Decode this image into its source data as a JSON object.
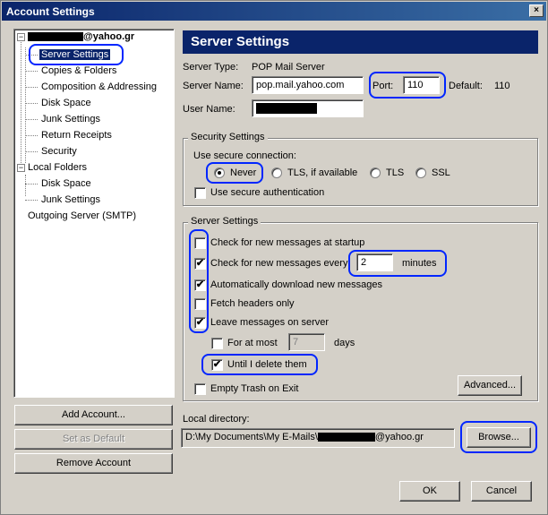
{
  "window": {
    "title": "Account Settings",
    "close_glyph": "×"
  },
  "tree": {
    "account_suffix": "@yahoo.gr",
    "account_expander": "−",
    "account_items": [
      "Server Settings",
      "Copies & Folders",
      "Composition & Addressing",
      "Disk Space",
      "Junk Settings",
      "Return Receipts",
      "Security"
    ],
    "local_folders": "Local Folders",
    "local_expander": "−",
    "local_items": [
      "Disk Space",
      "Junk Settings"
    ],
    "outgoing": "Outgoing Server (SMTP)"
  },
  "left_buttons": {
    "add": "Add Account...",
    "default": "Set as Default",
    "remove": "Remove Account"
  },
  "panel": {
    "header": "Server Settings",
    "server_type_label": "Server Type:",
    "server_type_value": "POP Mail Server",
    "server_name_label": "Server Name:",
    "server_name_value": "pop.mail.yahoo.com",
    "port_label": "Port:",
    "port_value": "110",
    "default_label": "Default:",
    "default_value": "110",
    "user_name_label": "User Name:"
  },
  "security": {
    "title": "Security Settings",
    "use_secure_label": "Use secure connection:",
    "options": [
      "Never",
      "TLS, if available",
      "TLS",
      "SSL"
    ],
    "selected": "Never",
    "secure_auth_label": "Use secure authentication"
  },
  "server_settings": {
    "title": "Server Settings",
    "check_startup": "Check for new messages at startup",
    "check_every": "Check for new messages every",
    "minutes_value": "2",
    "minutes_label": "minutes",
    "auto_download": "Automatically download new messages",
    "fetch_headers": "Fetch headers only",
    "leave_on_server": "Leave messages on server",
    "for_at_most": "For at most",
    "days_value": "7",
    "days_label": "days",
    "until_delete": "Until I delete them",
    "empty_trash": "Empty Trash on Exit",
    "advanced_button": "Advanced...",
    "check_mark": "✔"
  },
  "local_directory": {
    "label": "Local directory:",
    "path_prefix": "D:\\My Documents\\My E-Mails\\",
    "path_suffix": "@yahoo.gr",
    "browse_button": "Browse..."
  },
  "footer": {
    "ok": "OK",
    "cancel": "Cancel"
  },
  "colors": {
    "highlight": "#0026ff",
    "selection": "#0a246a",
    "dialog": "#d4d0c8"
  }
}
